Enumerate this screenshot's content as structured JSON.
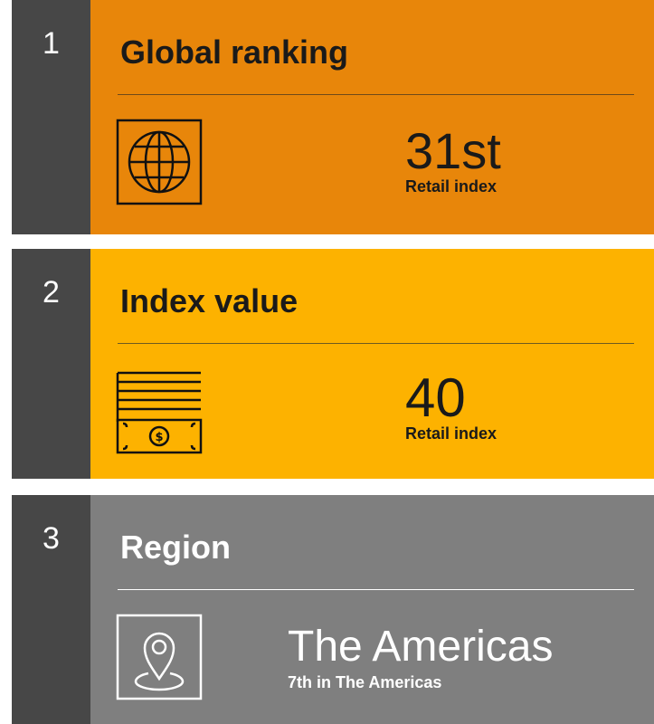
{
  "cards": [
    {
      "number": "1",
      "title": "Global ranking",
      "icon": "globe-icon",
      "value": "31st",
      "subtitle": "Retail index",
      "color": "#e8860a"
    },
    {
      "number": "2",
      "title": "Index value",
      "icon": "money-icon",
      "value": "40",
      "subtitle": "Retail index",
      "color": "#fdb200"
    },
    {
      "number": "3",
      "title": "Region",
      "icon": "location-pin-icon",
      "value": "The Americas",
      "subtitle": "7th in The Americas",
      "color": "#7f7f7f"
    }
  ],
  "number_column_color": "#474747"
}
